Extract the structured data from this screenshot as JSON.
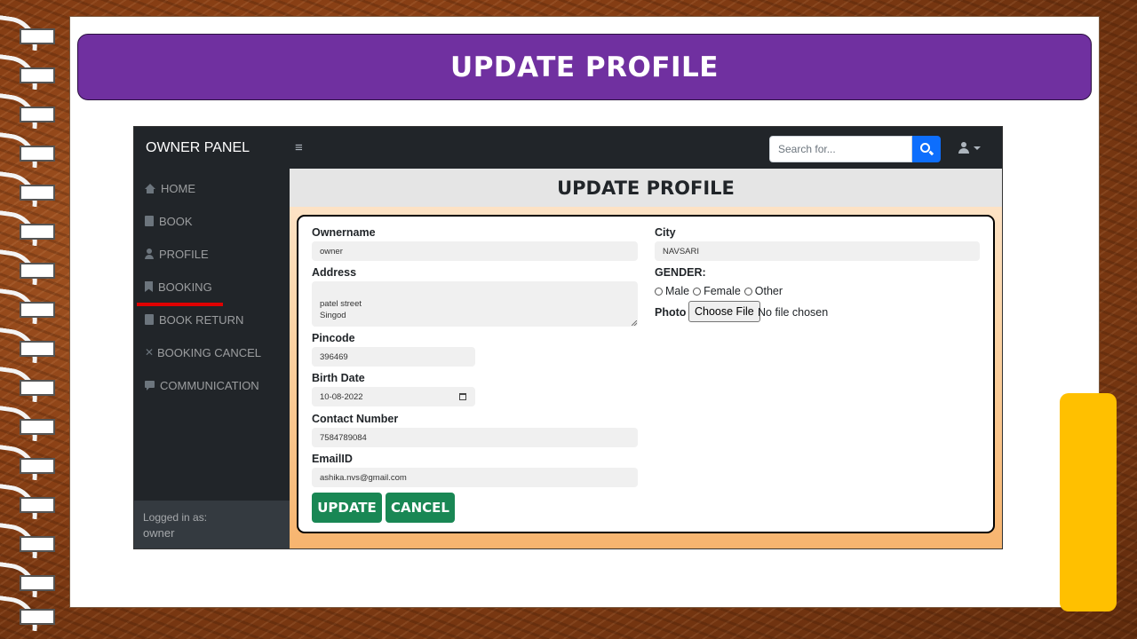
{
  "slide": {
    "title": "UPDATE PROFILE"
  },
  "app": {
    "brand": "OWNER PANEL",
    "toggle_icon": "≡",
    "search": {
      "placeholder": "Search for..."
    }
  },
  "sidebar": {
    "items": [
      {
        "label": "HOME",
        "icon": "home-icon"
      },
      {
        "label": "BOOK",
        "icon": "book-icon"
      },
      {
        "label": "PROFILE",
        "icon": "user-icon"
      },
      {
        "label": "BOOKING",
        "icon": "bookmark-icon"
      },
      {
        "label": "BOOK RETURN",
        "icon": "book-icon"
      },
      {
        "label": "BOOKING CANCEL",
        "icon": "close-icon"
      },
      {
        "label": "COMMUNICATION",
        "icon": "comment-icon"
      }
    ],
    "footer": {
      "logged_in_label": "Logged in as:",
      "user": "owner"
    }
  },
  "page": {
    "heading": "UPDATE PROFILE"
  },
  "form": {
    "ownername": {
      "label": "Ownername",
      "value": "owner"
    },
    "address": {
      "label": "Address",
      "value": "patel street\nSingod"
    },
    "pincode": {
      "label": "Pincode",
      "value": "396469"
    },
    "birth_date": {
      "label": "Birth Date",
      "value": "10-08-2022"
    },
    "contact": {
      "label": "Contact Number",
      "value": "7584789084"
    },
    "email": {
      "label": "EmailID",
      "value": "ashika.nvs@gmail.com"
    },
    "city": {
      "label": "City",
      "value": "NAVSARI"
    },
    "gender": {
      "label": "GENDER:",
      "options": [
        "Male",
        "Female",
        "Other"
      ]
    },
    "photo": {
      "label": "Photo",
      "button": "Choose File",
      "status": "No file chosen"
    },
    "update_button": "UPDATE",
    "cancel_button": "CANCEL"
  },
  "colors": {
    "banner": "#7030a0",
    "accent_yellow": "#ffc000",
    "navbar": "#212529",
    "search_button": "#0d6efd",
    "button_green": "#198754",
    "highlight_red": "#e00000"
  }
}
